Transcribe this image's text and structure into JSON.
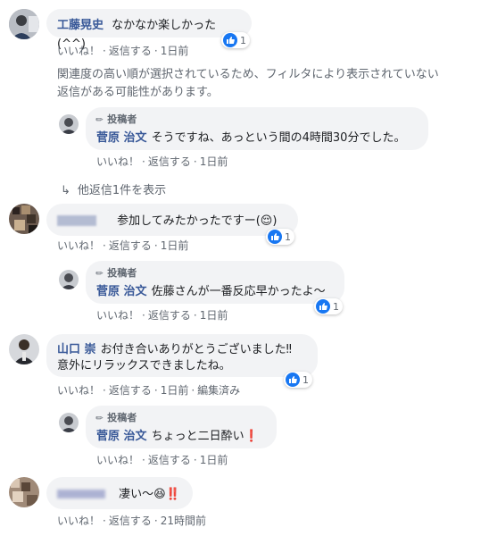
{
  "like_label": "いいね！",
  "reply_label": "返信する",
  "author_label": "投稿者",
  "reaction_count": "1",
  "comments": [
    {
      "name": "工藤晃史",
      "text": "なかなか楽しかった(^^)",
      "time": "1日前"
    },
    {
      "name": "",
      "text": "参加してみたかったですー(",
      "emoji": "😌",
      "text_after": ")",
      "time": "1日前"
    },
    {
      "name": "山口 崇",
      "line1": "お付き合いありがとうございました‼",
      "line2": "意外にリラックスできましたね。",
      "time": "1日前",
      "edited": "編集済み"
    },
    {
      "name": "",
      "text": "凄い〜",
      "emoji": "😆",
      "text_after": "‼️",
      "time": "21時間前"
    }
  ],
  "filter_note": {
    "line1": "関連度の高い順が選択されているため、フィルタにより表示されていない",
    "line2": "返信がある可能性があります。"
  },
  "replies": [
    {
      "name": "菅原 治文",
      "text": "そうですね、あっという間の4時間30分でした。",
      "time": "1日前"
    },
    {
      "name": "菅原 治文",
      "text": "佐藤さんが一番反応早かったよ〜",
      "time": "1日前"
    },
    {
      "name": "菅原 治文",
      "text": "ちょっと二日酔い",
      "emoji": "❗",
      "time": "1日前"
    }
  ],
  "more_replies": "他返信1件を表示",
  "colors": {
    "link": "#385898",
    "bubble": "#f2f3f5",
    "meta": "#606770",
    "like": "#1877f2"
  }
}
